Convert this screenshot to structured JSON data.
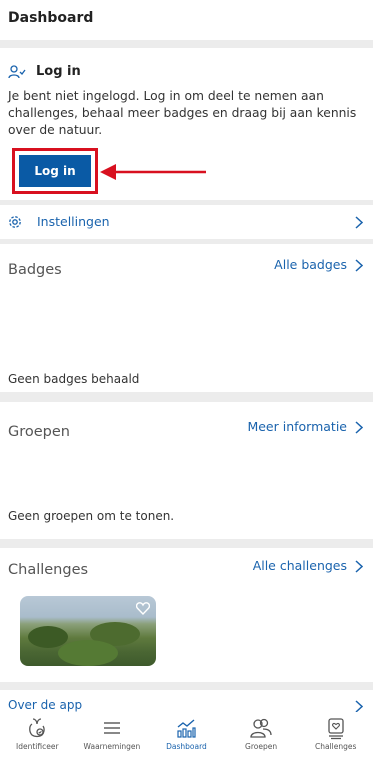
{
  "header": {
    "title": "Dashboard"
  },
  "login": {
    "label": "Log in",
    "text": "Je bent niet ingelogd. Log in om deel te nemen aan challenges, behaal meer badges en draag bij aan kennis over de natuur.",
    "button": "Log in"
  },
  "settings": {
    "label": "Instellingen"
  },
  "badges": {
    "title": "Badges",
    "link": "Alle badges",
    "empty": "Geen badges behaald"
  },
  "groups": {
    "title": "Groepen",
    "link": "Meer informatie",
    "empty": "Geen groepen om te tonen."
  },
  "challenges": {
    "title": "Challenges",
    "link": "Alle challenges"
  },
  "about": {
    "label": "Over de app"
  },
  "nav": [
    {
      "label": "Identificeer",
      "icon": "identify-icon"
    },
    {
      "label": "Waarnemingen",
      "icon": "list-icon"
    },
    {
      "label": "Dashboard",
      "icon": "dashboard-icon",
      "active": true
    },
    {
      "label": "Groepen",
      "icon": "groups-icon"
    },
    {
      "label": "Challenges",
      "icon": "challenges-icon"
    }
  ],
  "colors": {
    "accent": "#1a63ad",
    "button": "#0a5aa5",
    "highlight": "#d8101f"
  }
}
